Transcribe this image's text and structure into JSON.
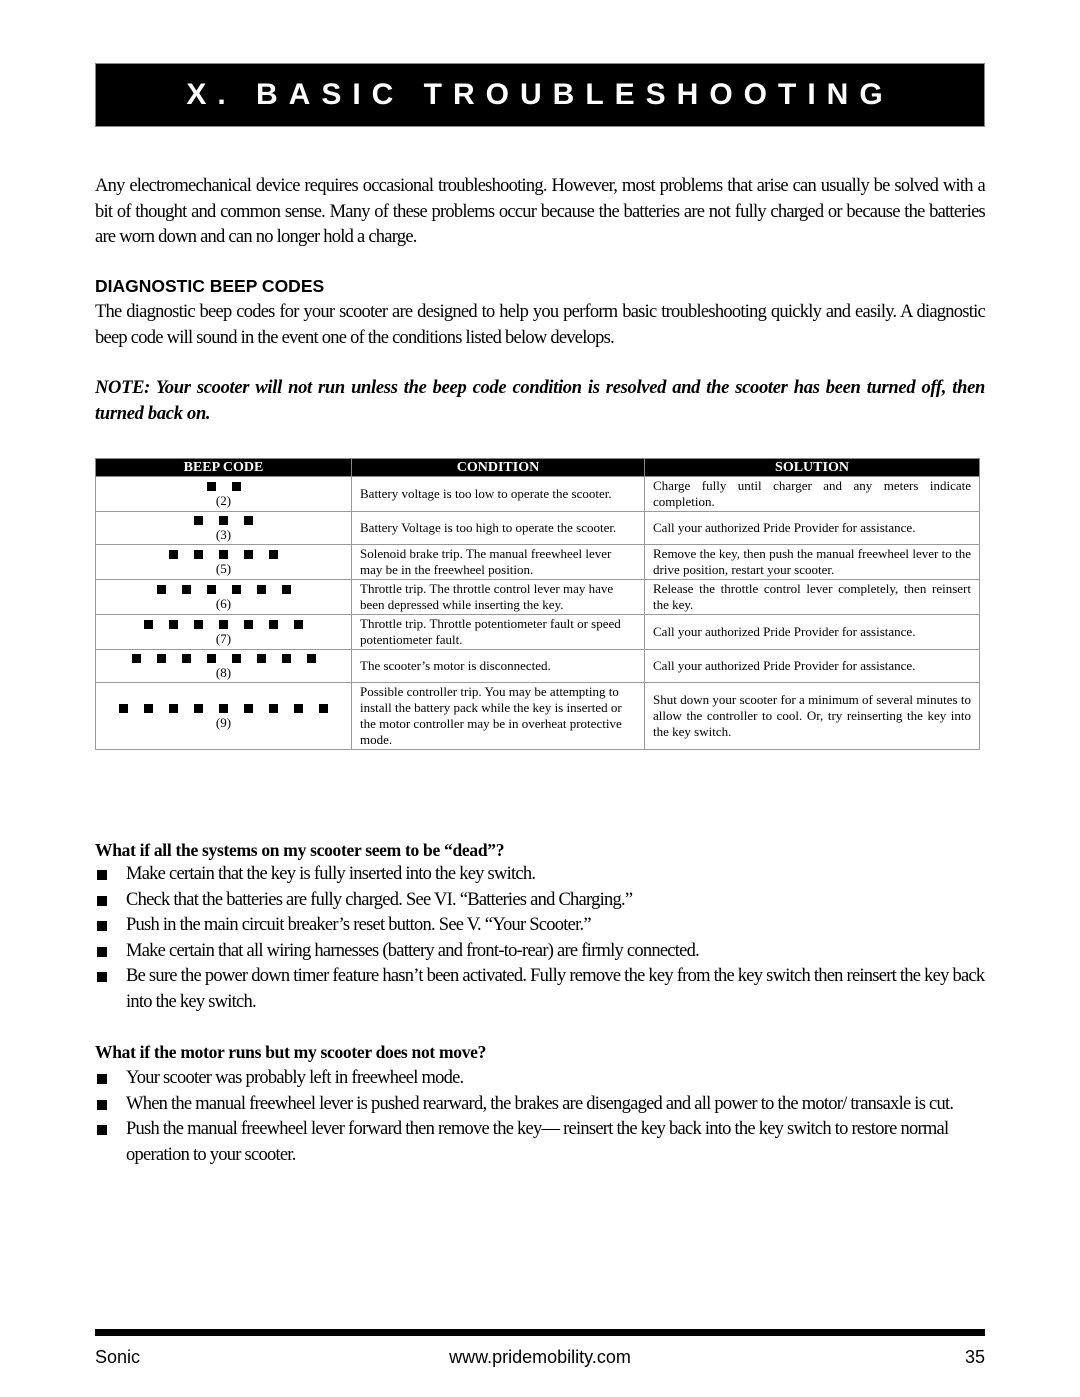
{
  "header": {
    "title": "X. BASIC TROUBLESHOOTING"
  },
  "intro": "Any electromechanical device requires occasional troubleshooting. However, most problems that arise can usually be solved with a bit of thought and common sense. Many of these problems occur because the batteries are not fully charged or because the batteries are worn down and can no longer hold a charge.",
  "diagnostic": {
    "heading": "DIAGNOSTIC BEEP CODES",
    "text": "The diagnostic beep codes for your scooter are designed to help you perform basic troubleshooting quickly and easily. A diagnostic beep code will sound in the event one of the conditions listed below develops.",
    "note": "NOTE: Your scooter will not run unless the beep code condition is resolved and the scooter has been turned off, then turned back on."
  },
  "table": {
    "headers": [
      "BEEP CODE",
      "CONDITION",
      "SOLUTION"
    ],
    "rows": [
      {
        "beeps": 2,
        "count_label": "(2)",
        "condition": "Battery voltage is too low to operate the scooter.",
        "solution": "Charge fully until charger and any meters indicate completion."
      },
      {
        "beeps": 3,
        "count_label": "(3)",
        "condition": "Battery Voltage is too high to operate the scooter.",
        "solution": "Call your authorized Pride Provider for assistance."
      },
      {
        "beeps": 5,
        "count_label": "(5)",
        "condition": "Solenoid brake trip. The manual freewheel lever may be in the freewheel position.",
        "solution": "Remove the key, then push the manual freewheel lever to the drive position, restart your scooter."
      },
      {
        "beeps": 6,
        "count_label": "(6)",
        "condition": "Throttle trip. The throttle control lever may have been depressed while inserting the key.",
        "solution": "Release the throttle control lever completely, then reinsert the key."
      },
      {
        "beeps": 7,
        "count_label": "(7)",
        "condition": "Throttle trip. Throttle potentiometer fault or speed potentiometer fault.",
        "solution": "Call your authorized Pride Provider for assistance."
      },
      {
        "beeps": 8,
        "count_label": "(8)",
        "condition": "The scooter’s motor is disconnected.",
        "solution": "Call your authorized Pride Provider for assistance."
      },
      {
        "beeps": 9,
        "count_label": "(9)",
        "condition": "Possible controller trip. You may be attempting to install the battery pack while the key is inserted or the motor controller may be in overheat protective mode.",
        "solution": "Shut down your scooter for a minimum of several minutes to allow the controller to cool. Or, try reinserting the key into the key switch."
      }
    ]
  },
  "faq": [
    {
      "question": "What if all the systems on my scooter seem to be “dead”?",
      "items": [
        "Make certain that the key is fully inserted into the key switch.",
        "Check that the batteries are fully charged. See VI. “Batteries and Charging.”",
        "Push in the main circuit breaker’s reset button. See V. “Your Scooter.”",
        "Make certain that all wiring harnesses (battery and front-to-rear) are firmly connected.",
        "Be sure the power down timer feature hasn’t been activated. Fully remove the key from the key switch then reinsert the key back into the key switch."
      ]
    },
    {
      "question": "What if the motor runs but my scooter does not move?",
      "items": [
        "Your scooter was probably left in freewheel mode.",
        "When the manual freewheel lever is pushed rearward, the brakes are disengaged and all power to the motor/ transaxle is cut.",
        "Push the manual freewheel lever forward then remove the key— reinsert the key back into the key switch to restore normal operation to your scooter."
      ]
    }
  ],
  "footer": {
    "product": "Sonic",
    "url": "www.pridemobility.com",
    "page": "35"
  }
}
